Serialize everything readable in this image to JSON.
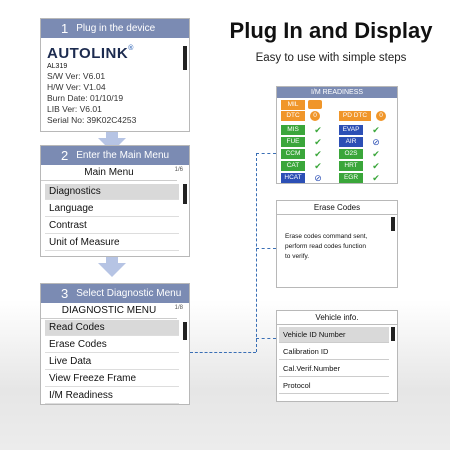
{
  "headline": "Plug In and Display",
  "subline": "Easy to use with simple steps",
  "step1": {
    "num": "1",
    "label": "Plug in the device",
    "brand": "AUTOLINK",
    "model": "AL319",
    "lines": [
      "S/W Ver: V6.01",
      "H/W Ver: V1.04",
      "Burn Date: 01/10/19",
      "LIB Ver: V6.01",
      "Serial No: 39K02C4253"
    ]
  },
  "step2": {
    "num": "2",
    "label": "Enter the Main Menu",
    "title": "Main Menu",
    "page": "1/6",
    "items": [
      "Diagnostics",
      "Language",
      "Contrast",
      "Unit of Measure"
    ]
  },
  "step3": {
    "num": "3",
    "label": "Select Diagnostic Menu",
    "title": "DIAGNOSTIC MENU",
    "page": "1/8",
    "items": [
      "Read Codes",
      "Erase Codes",
      "Live  Data",
      "View Freeze Frame",
      "I/M Readiness"
    ]
  },
  "im": {
    "title": "I/M READINESS",
    "mil": "MIL",
    "dtc": "DTC",
    "dtc_val": "0",
    "pd": "PD DTC",
    "pd_val": "0",
    "left": [
      "MIS",
      "FUE",
      "CCM",
      "CAT",
      "HCAT"
    ],
    "right": [
      "EVAP",
      "AIR",
      "O2S",
      "HRT",
      "EGR"
    ],
    "colors": {
      "green": "#3aa63a",
      "blue": "#2c4fb5",
      "orange": "#f0962a"
    }
  },
  "erase": {
    "title": "Erase Codes",
    "lines": [
      "Erase codes command sent,",
      "perform read codes function",
      "to verify."
    ]
  },
  "vehicle": {
    "title": "Vehicle info.",
    "items": [
      "Vehicle ID Number",
      "Calibration ID",
      "Cal.Verif.Number",
      "Protocol"
    ]
  }
}
